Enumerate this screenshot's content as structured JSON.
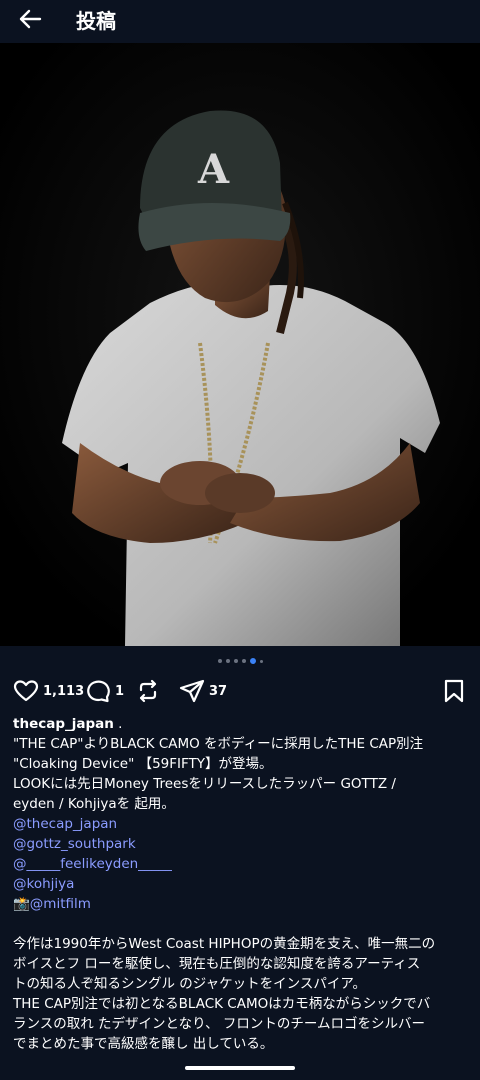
{
  "header": {
    "title": "投稿"
  },
  "actions": {
    "likes": "1,113",
    "comments": "1",
    "shares": "37"
  },
  "carousel": {
    "total": 6,
    "active_index": 4
  },
  "caption": {
    "username": "thecap_japan",
    "separator": ".",
    "lines": [
      "\"THE CAP\"よりBLACK CAMO をボディーに採用したTHE CAP別注",
      "\"Cloaking Device\" 【59FIFTY】が登場。",
      "LOOKには先日Money Treesをリリースしたラッパー GOTTZ /",
      "eyden / Kohjiyaを 起用。"
    ],
    "mentions": [
      "@thecap_japan",
      "@gottz_southpark",
      "@_____feelikeyden_____",
      "@kohjiya",
      "📸@mitfilm"
    ],
    "paragraph_lines": [
      "今作は1990年からWest Coast HIPHOPの黄金期を支え、唯一無二の",
      "ボイスとフ ローを駆使し、現在も圧倒的な認知度を誇るアーティス",
      "トの知る人ぞ知るシングル のジャケットをインスパイア。",
      "THE CAP別注では初となるBLACK CAMOはカモ柄ながらシックでバ",
      "ランスの取れ たデザインとなり、 フロントのチームロゴをシルバー",
      "でまとめた事で高級感を醸し 出している。"
    ]
  }
}
